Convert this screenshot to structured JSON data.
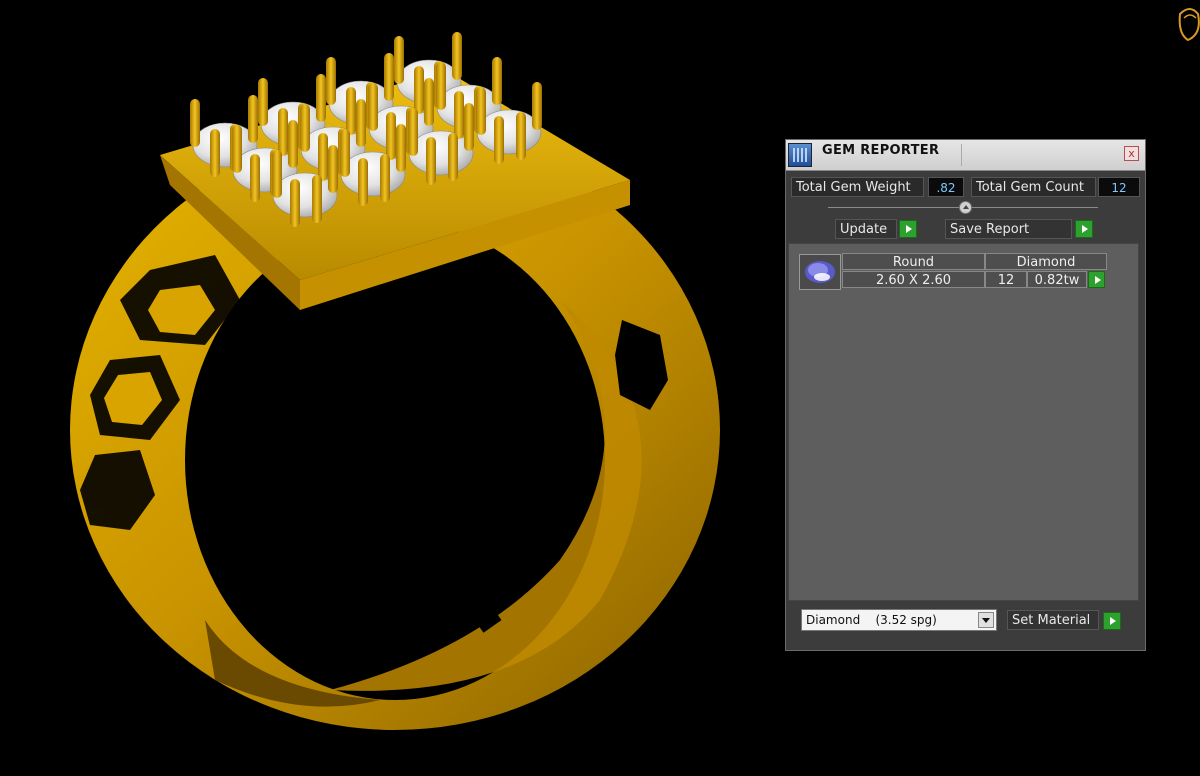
{
  "gem_reporter": {
    "title": "GEM REPORTER",
    "close_symbol": "x",
    "total_gem_weight_label": "Total Gem Weight",
    "total_gem_weight_value": ".82",
    "total_gem_count_label": "Total Gem Count",
    "total_gem_count_value": "12",
    "update_label": "Update",
    "save_report_label": "Save Report",
    "gems": [
      {
        "shape": "Round",
        "material": "Diamond",
        "size": "2.60 X 2.60",
        "count": "12",
        "weight": "0.82tw"
      }
    ],
    "material_select": {
      "name": "Diamond",
      "spg": "(3.52 spg)"
    },
    "set_material_label": "Set Material"
  },
  "colors": {
    "background": "#000000",
    "gold": "#d9a400",
    "panel": "#3c3c3c",
    "accent_green": "#2ea02e",
    "value_blue": "#7ec8ff"
  }
}
